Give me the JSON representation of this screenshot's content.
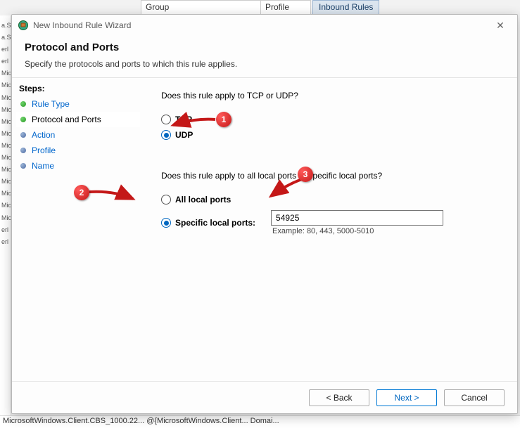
{
  "bg": {
    "col_group": "Group",
    "col_profile": "Profile",
    "tab": "Inbound Rules",
    "strip": [
      "a.Si",
      "a.Si",
      "",
      "erl",
      "erl",
      "",
      "Mic",
      "Mic",
      "Mic",
      "",
      "Mic",
      "Mic",
      "",
      "Mic",
      "Mic",
      "",
      "Mic",
      "Mic",
      "",
      "Mic",
      "",
      "Mic",
      "Mic",
      "",
      "Mic",
      "erl",
      "erl"
    ],
    "status": "MicrosoftWindows.Client.CBS_1000.22...   @{MicrosoftWindows.Client...   Domai..."
  },
  "dialog": {
    "title": "New Inbound Rule Wizard",
    "close_glyph": "✕",
    "heading": "Protocol and Ports",
    "subtitle": "Specify the protocols and ports to which this rule applies."
  },
  "steps": {
    "label": "Steps:",
    "items": [
      {
        "label": "Rule Type",
        "state": "done link"
      },
      {
        "label": "Protocol and Ports",
        "state": "current"
      },
      {
        "label": "Action",
        "state": "pending link"
      },
      {
        "label": "Profile",
        "state": "pending link"
      },
      {
        "label": "Name",
        "state": "pending link"
      }
    ]
  },
  "content": {
    "q1": "Does this rule apply to TCP or UDP?",
    "tcp": "TCP",
    "udp": "UDP",
    "q2": "Does this rule apply to all local ports or specific local ports?",
    "all_ports": "All local ports",
    "specific_ports": "Specific local ports:",
    "port_value": "54925",
    "example": "Example: 80, 443, 5000-5010"
  },
  "footer": {
    "back": "< Back",
    "next": "Next >",
    "cancel": "Cancel"
  },
  "callouts": {
    "c1": "1",
    "c2": "2",
    "c3": "3"
  }
}
